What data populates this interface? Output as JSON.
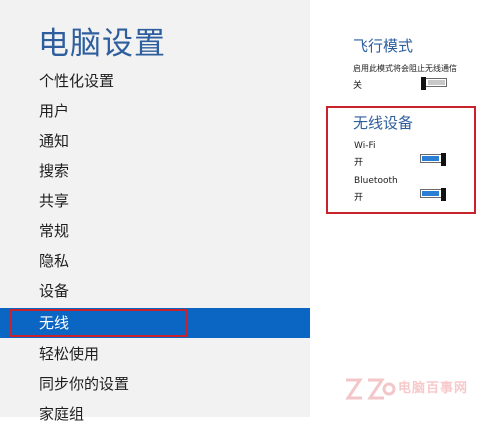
{
  "page_title": "电脑设置",
  "nav": [
    {
      "label": "个性化设置",
      "selected": false
    },
    {
      "label": "用户",
      "selected": false
    },
    {
      "label": "通知",
      "selected": false
    },
    {
      "label": "搜索",
      "selected": false
    },
    {
      "label": "共享",
      "selected": false
    },
    {
      "label": "常规",
      "selected": false
    },
    {
      "label": "隐私",
      "selected": false
    },
    {
      "label": "设备",
      "selected": false
    },
    {
      "label": "无线",
      "selected": true
    },
    {
      "label": "轻松使用",
      "selected": false
    },
    {
      "label": "同步你的设置",
      "selected": false
    },
    {
      "label": "家庭组",
      "selected": false
    }
  ],
  "airplane": {
    "title": "飞行模式",
    "description": "启用此模式将会阻止无线通信",
    "state": "关",
    "on": false
  },
  "wireless_devices": {
    "title": "无线设备",
    "wifi": {
      "label": "Wi-Fi",
      "state": "开",
      "on": true
    },
    "bluetooth": {
      "label": "Bluetooth",
      "state": "开",
      "on": true
    }
  },
  "watermark": {
    "text": "电脑百事网"
  },
  "colors": {
    "accent": "#0a66c2",
    "title": "#2e5e9e",
    "highlight_frame": "#c8232c",
    "toggle_on": "#2a7fd4"
  }
}
